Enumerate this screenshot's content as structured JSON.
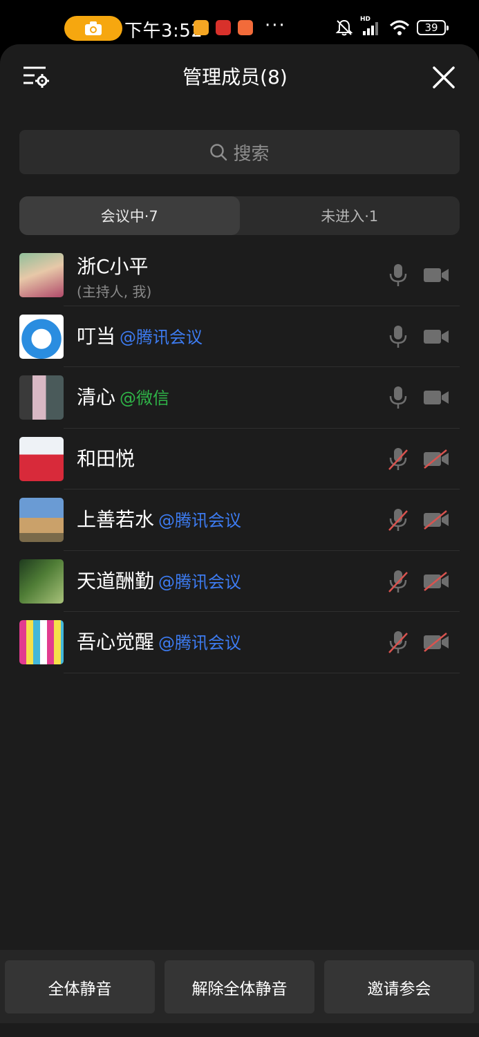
{
  "status_bar": {
    "time": "下午3:52",
    "dots": "···",
    "battery": "39",
    "network_badge": "HD"
  },
  "header": {
    "title": "管理成员(8)"
  },
  "search": {
    "placeholder": "搜索"
  },
  "tabs": [
    {
      "label": "会议中·7",
      "active": true
    },
    {
      "label": "未进入·1",
      "active": false
    }
  ],
  "members": [
    {
      "name": "浙C小平",
      "tag": "",
      "sub": "(主持人, 我)",
      "mic": "on",
      "camera": "off"
    },
    {
      "name": "叮当",
      "tag": "@腾讯会议",
      "sub": "",
      "mic": "on",
      "camera": "off"
    },
    {
      "name": "清心",
      "tag": "@微信",
      "sub": "",
      "mic": "on",
      "camera": "off"
    },
    {
      "name": "和田悦",
      "tag": "",
      "sub": "",
      "mic": "muted",
      "camera": "disabled"
    },
    {
      "name": "上善若水",
      "tag": "@腾讯会议",
      "sub": "",
      "mic": "muted",
      "camera": "disabled"
    },
    {
      "name": "天道酬勤",
      "tag": "@腾讯会议",
      "sub": "",
      "mic": "muted",
      "camera": "disabled"
    },
    {
      "name": "吾心觉醒",
      "tag": "@腾讯会议",
      "sub": "",
      "mic": "muted",
      "camera": "disabled"
    }
  ],
  "actions": {
    "mute_all": "全体静音",
    "unmute_all": "解除全体静音",
    "invite": "邀请参会"
  },
  "colors": {
    "tag_tencent": "#3d7bf0",
    "tag_wechat": "#2fb548",
    "muted_red": "#d9534f",
    "camera_pill": "#f6a70f"
  }
}
